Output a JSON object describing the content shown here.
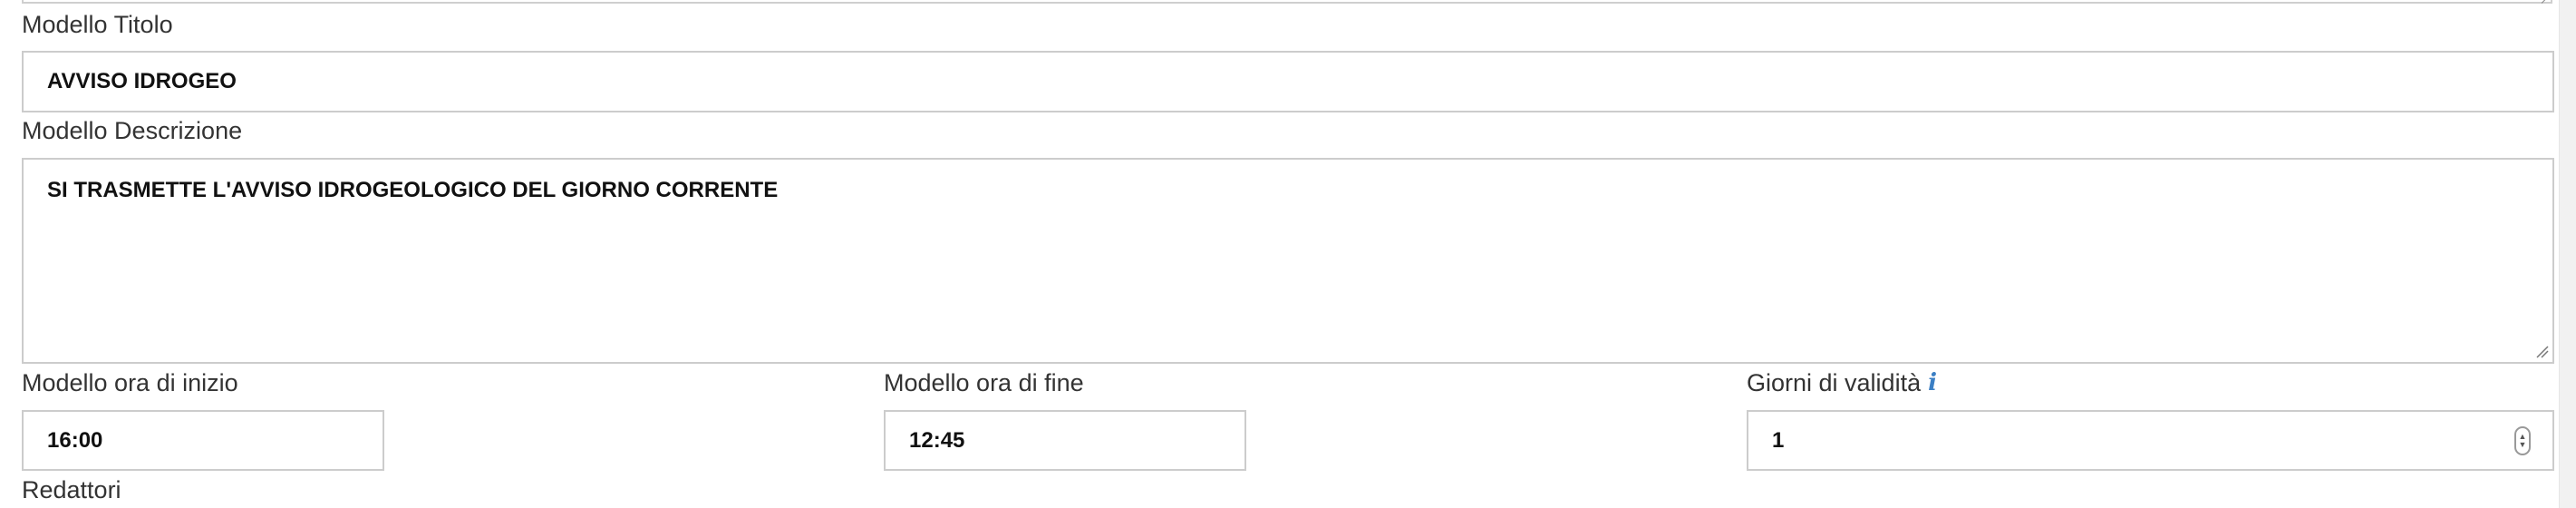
{
  "form": {
    "title_label": "Modello Titolo",
    "title_value": "AVVISO IDROGEO",
    "description_label": "Modello Descrizione",
    "description_value": "SI TRASMETTE L'AVVISO IDROGEOLOGICO DEL GIORNO CORRENTE",
    "start_time_label": "Modello ora di inizio",
    "start_time_value": "16:00",
    "end_time_label": "Modello ora di fine",
    "end_time_value": "12:45",
    "validity_label": "Giorni di validità",
    "validity_value": "1",
    "editors_label": "Redattori"
  },
  "icons": {
    "info": "info-icon",
    "spinner": "number-spinner-icon",
    "resize": "resize-grip-icon"
  },
  "colors": {
    "border": "#cccccc",
    "info_icon": "#3b7fc4",
    "text": "#333333"
  }
}
